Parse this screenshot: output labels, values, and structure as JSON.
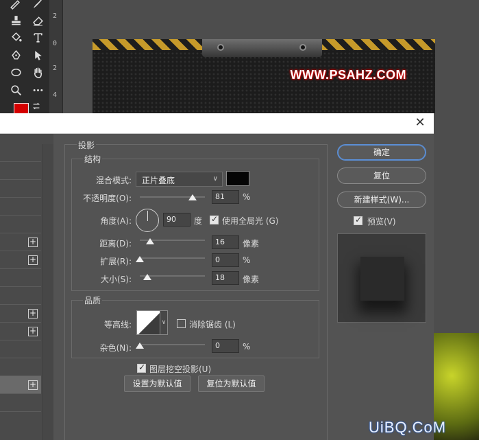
{
  "app": {
    "ruler_numbers": [
      "2",
      "0",
      "2",
      "4"
    ],
    "foreground_color": "#d40000"
  },
  "canvas": {
    "watermark_text": "WWW.PSAHZ.COM"
  },
  "dialog": {
    "close_glyph": "✕",
    "drop_shadow": {
      "title": "投影",
      "structure": {
        "title": "结构",
        "blend_mode_label": "混合模式:",
        "blend_mode_value": "正片叠底",
        "shadow_color": "#050505",
        "opacity_label": "不透明度(O):",
        "opacity_value": "81",
        "opacity_unit": "%",
        "opacity_fraction": 0.81,
        "angle_label": "角度(A):",
        "angle_value": "90",
        "angle_unit": "度",
        "global_light_label": "使用全局光 (G)",
        "global_light_checked": true,
        "distance_label": "距离(D):",
        "distance_value": "16",
        "distance_unit": "像素",
        "spread_label": "扩展(R):",
        "spread_value": "0",
        "spread_unit": "%",
        "size_label": "大小(S):",
        "size_value": "18",
        "size_unit": "像素"
      },
      "quality": {
        "title": "品质",
        "contour_label": "等高线:",
        "anti_alias_label": "消除锯齿 (L)",
        "anti_alias_checked": false,
        "noise_label": "杂色(N):",
        "noise_value": "0",
        "noise_unit": "%"
      },
      "knockout_label": "图层挖空投影(U)",
      "knockout_checked": true,
      "make_default_label": "设置为默认值",
      "reset_default_label": "复位为默认值"
    },
    "ok_label": "确定",
    "reset_label": "复位",
    "new_style_label": "新建样式(W)...",
    "preview_label": "预览(V)",
    "preview_checked": true
  },
  "site_watermark": "UiBQ.CoM"
}
